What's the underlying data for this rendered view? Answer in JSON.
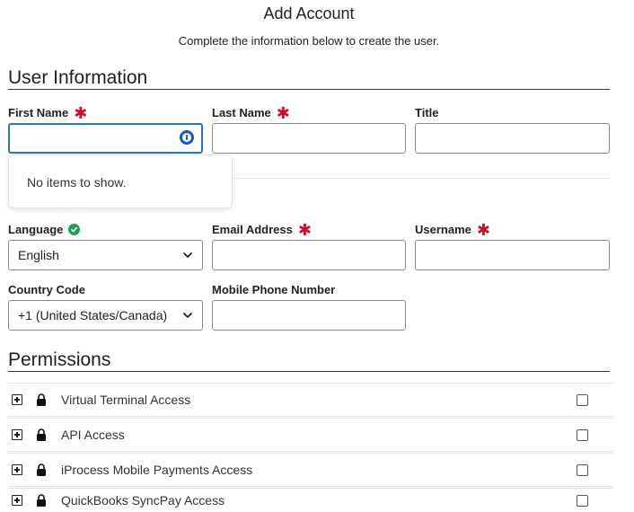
{
  "header": {
    "title": "Add Account",
    "subtitle": "Complete the information below to create the user."
  },
  "user_info": {
    "section_title": "User Information",
    "first_name": {
      "label": "First Name",
      "value": "",
      "required": true
    },
    "last_name": {
      "label": "Last Name",
      "value": "",
      "required": true
    },
    "title": {
      "label": "Title",
      "value": ""
    },
    "autofill_dropdown": {
      "message": "No items to show."
    },
    "language": {
      "label": "Language",
      "selected": "English",
      "status_icon": "check-circle-icon"
    },
    "email": {
      "label": "Email Address",
      "value": "",
      "required": true
    },
    "username": {
      "label": "Username",
      "value": "",
      "required": true
    },
    "country_code": {
      "label": "Country Code",
      "selected": "+1 (United States/Canada)"
    },
    "mobile_phone": {
      "label": "Mobile Phone Number",
      "value": ""
    }
  },
  "permissions": {
    "section_title": "Permissions",
    "items": [
      {
        "label": "Virtual Terminal Access",
        "checked": false
      },
      {
        "label": "API Access",
        "checked": false
      },
      {
        "label": "iProcess Mobile Payments Access",
        "checked": false
      },
      {
        "label": "QuickBooks SyncPay Access",
        "checked": false
      }
    ]
  },
  "colors": {
    "required_asterisk": "#c8102e",
    "focus_border": "#2a6fd6",
    "section_rule": "#5a2a3a",
    "success_badge": "#1f9d55"
  }
}
